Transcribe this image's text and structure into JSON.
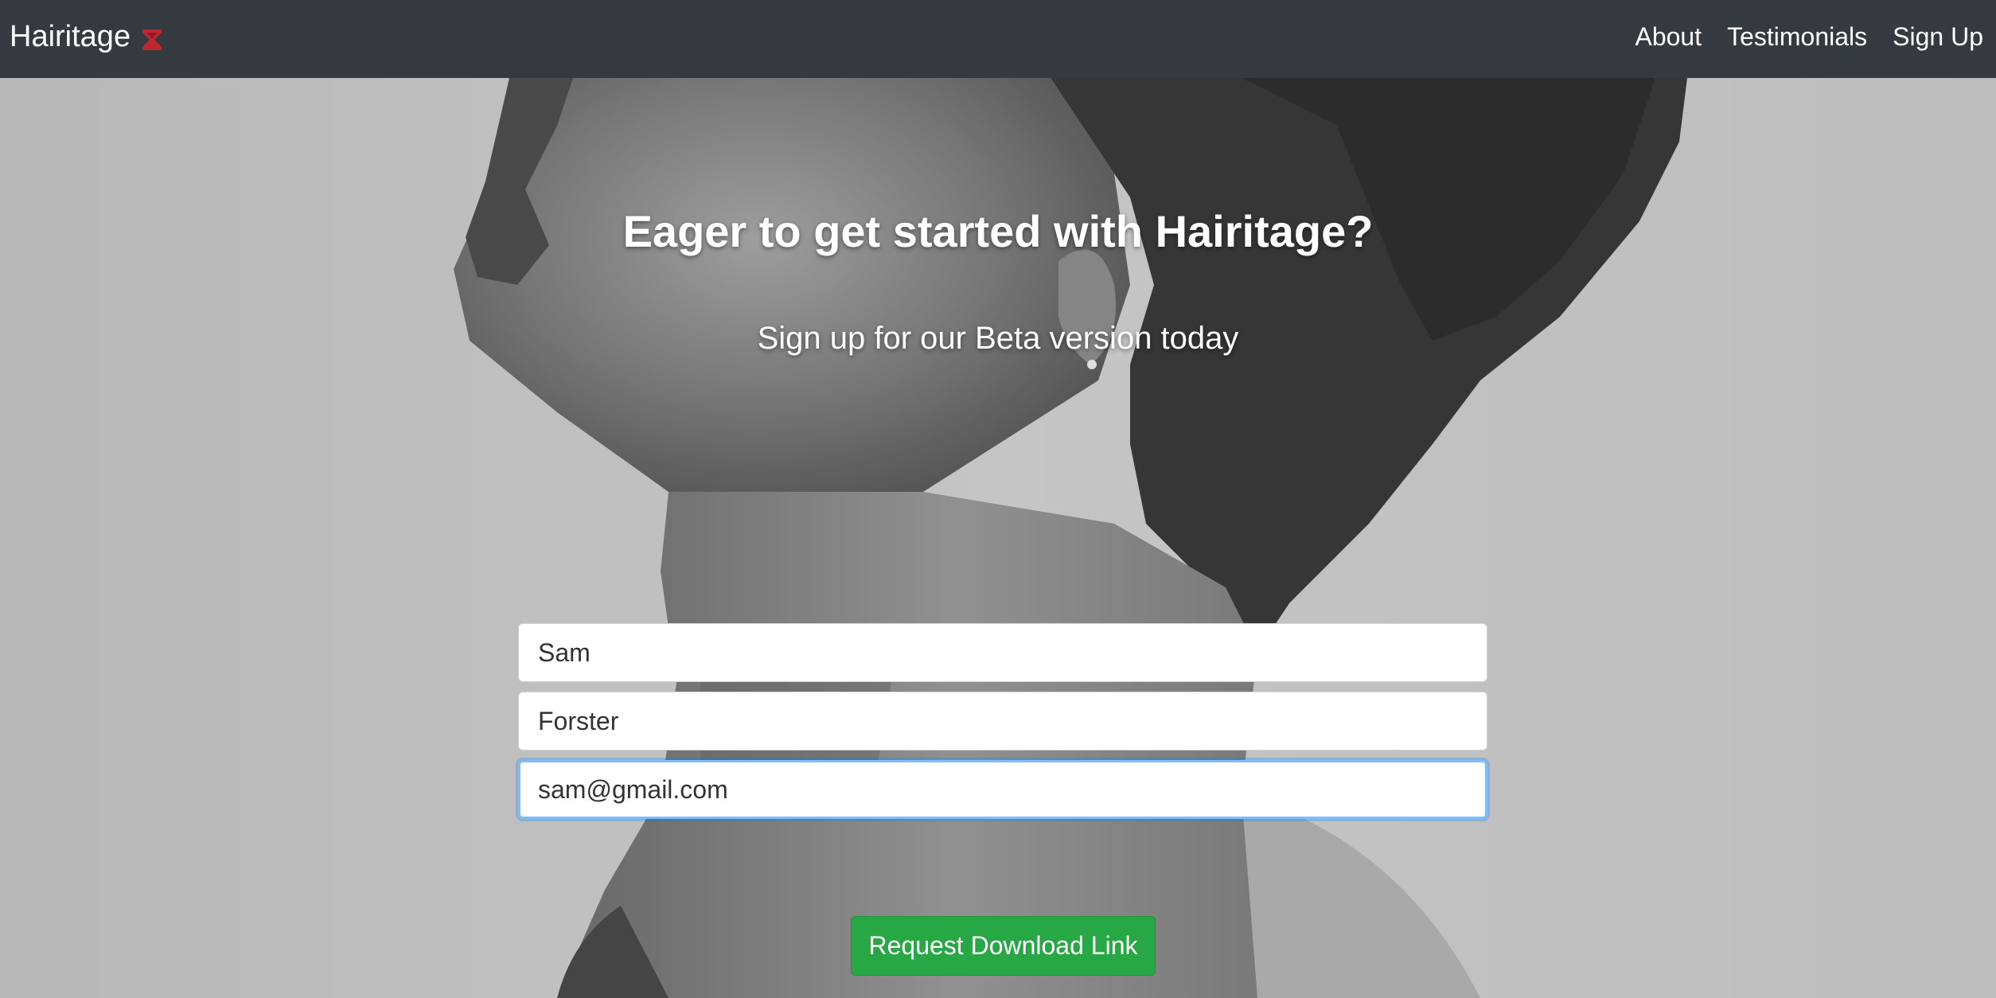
{
  "navbar": {
    "brand": "Hairitage",
    "brand_icon": "hourglass-icon",
    "brand_icon_color": "#c0262d",
    "links": [
      {
        "label": "About"
      },
      {
        "label": "Testimonials"
      },
      {
        "label": "Sign Up"
      }
    ],
    "background": "#343a40"
  },
  "hero": {
    "image": "grayscale-portrait-photo",
    "headline": "Eager to get started with Hairitage?",
    "subheadline": "Sign up for our Beta version today"
  },
  "form": {
    "first_name": "Sam",
    "last_name": "Forster",
    "email": "sam@gmail.com",
    "submit_label": "Request Download Link",
    "submit_color": "#28a745"
  }
}
